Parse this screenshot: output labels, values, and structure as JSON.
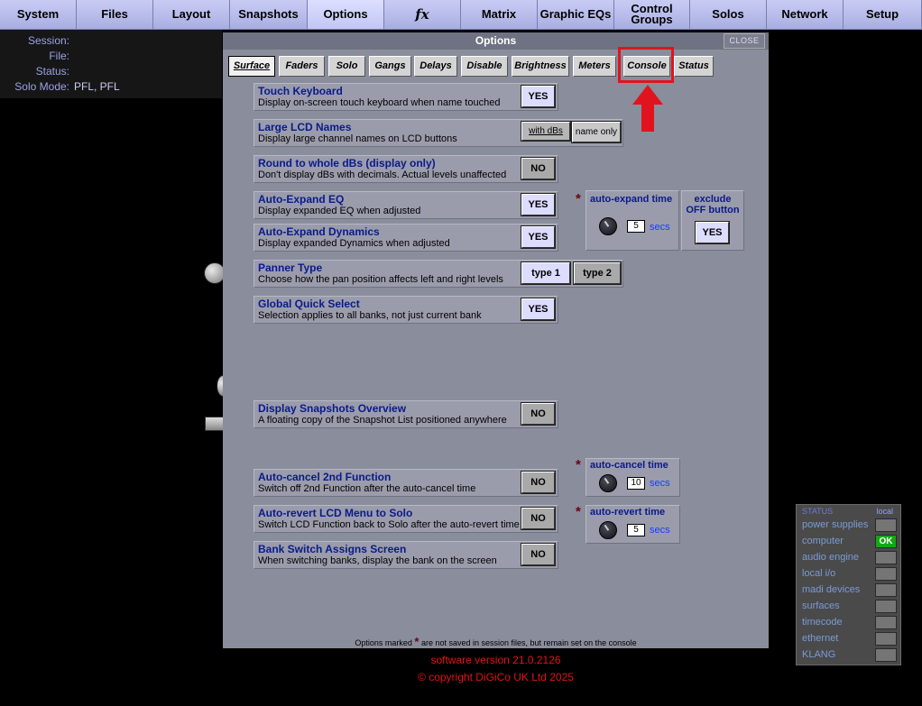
{
  "topnav": {
    "tabs": [
      {
        "label": "System"
      },
      {
        "label": "Files"
      },
      {
        "label": "Layout"
      },
      {
        "label": "Snapshots"
      },
      {
        "label": "Options",
        "active": true
      },
      {
        "label": "fx"
      },
      {
        "label": "Matrix"
      },
      {
        "label": "Graphic EQs"
      },
      {
        "label": "Control Groups"
      },
      {
        "label": "Solos"
      },
      {
        "label": "Network"
      },
      {
        "label": "Setup"
      }
    ]
  },
  "session_info": {
    "session_label": "Session:",
    "session_value": "",
    "file_label": "File:",
    "file_value": "",
    "status_label": "Status:",
    "status_value": "",
    "solo_mode_label": "Solo Mode:",
    "solo_mode_value": "PFL, PFL"
  },
  "panel": {
    "title": "Options",
    "close_label": "CLOSE",
    "subtabs": [
      "Surface",
      "Faders",
      "Solo",
      "Gangs",
      "Delays",
      "Disable",
      "Brightness",
      "Meters",
      "Console",
      "Status"
    ],
    "active_subtab": "Surface",
    "options": {
      "touch_keyboard": {
        "title": "Touch Keyboard",
        "desc": "Display on-screen touch keyboard when name touched",
        "button": "YES"
      },
      "large_lcd_names": {
        "title": "Large LCD Names",
        "desc": "Display large channel names on LCD buttons",
        "button_a": "with dBs",
        "button_b": "name only"
      },
      "round_dbs": {
        "title": "Round to whole dBs (display only)",
        "desc": "Don't display dBs with decimals. Actual levels unaffected",
        "button": "NO"
      },
      "auto_expand_eq": {
        "title": "Auto-Expand EQ",
        "desc": "Display expanded EQ when adjusted",
        "button": "YES"
      },
      "auto_expand_dyn": {
        "title": "Auto-Expand Dynamics",
        "desc": "Display expanded Dynamics when adjusted",
        "button": "YES"
      },
      "panner_type": {
        "title": "Panner Type",
        "desc": "Choose how the pan position affects left and right levels",
        "button_a": "type 1",
        "button_b": "type 2"
      },
      "global_quick_select": {
        "title": "Global Quick Select",
        "desc": "Selection applies to all banks, not just current bank",
        "button": "YES"
      },
      "snapshots_overview": {
        "title": "Display Snapshots Overview",
        "desc": "A floating copy of the Snapshot List positioned anywhere",
        "button": "NO"
      },
      "auto_cancel": {
        "title": "Auto-cancel 2nd Function",
        "desc": "Switch off 2nd Function after the auto-cancel time",
        "button": "NO"
      },
      "auto_revert": {
        "title": "Auto-revert LCD Menu to Solo",
        "desc": "Switch LCD Function back to Solo after the auto-revert time",
        "button": "NO"
      },
      "bank_switch": {
        "title": "Bank Switch Assigns Screen",
        "desc": "When switching banks, display the bank on the screen",
        "button": "NO"
      }
    },
    "auto_expand_time": {
      "label": "auto-expand time",
      "value": "5",
      "unit": "secs"
    },
    "exclude_off": {
      "label_line1": "exclude",
      "label_line2": "OFF button",
      "button": "YES"
    },
    "auto_cancel_time": {
      "label": "auto-cancel time",
      "value": "10",
      "unit": "secs"
    },
    "auto_revert_time": {
      "label": "auto-revert time",
      "value": "5",
      "unit": "secs"
    },
    "footer_pre": "Options marked",
    "footer_post": "are not saved in session files, but remain set on the console",
    "asterisk": "*"
  },
  "software": {
    "version": "software version 21.0.2126",
    "copyright": "© copyright DiGiCo UK Ltd 2025"
  },
  "status_panel": {
    "header": "STATUS",
    "local": "local",
    "items": [
      {
        "label": "power supplies",
        "value": ""
      },
      {
        "label": "computer",
        "value": "OK"
      },
      {
        "label": "audio engine",
        "value": ""
      },
      {
        "label": "local i/o",
        "value": ""
      },
      {
        "label": "madi devices",
        "value": ""
      },
      {
        "label": "surfaces",
        "value": ""
      },
      {
        "label": "timecode",
        "value": ""
      },
      {
        "label": "ethernet",
        "value": ""
      },
      {
        "label": "KLANG",
        "value": ""
      }
    ]
  },
  "colors": {
    "annotation": "#e0141e",
    "ok_indicator": "#12a812",
    "title_blue": "#0a1a8c"
  }
}
